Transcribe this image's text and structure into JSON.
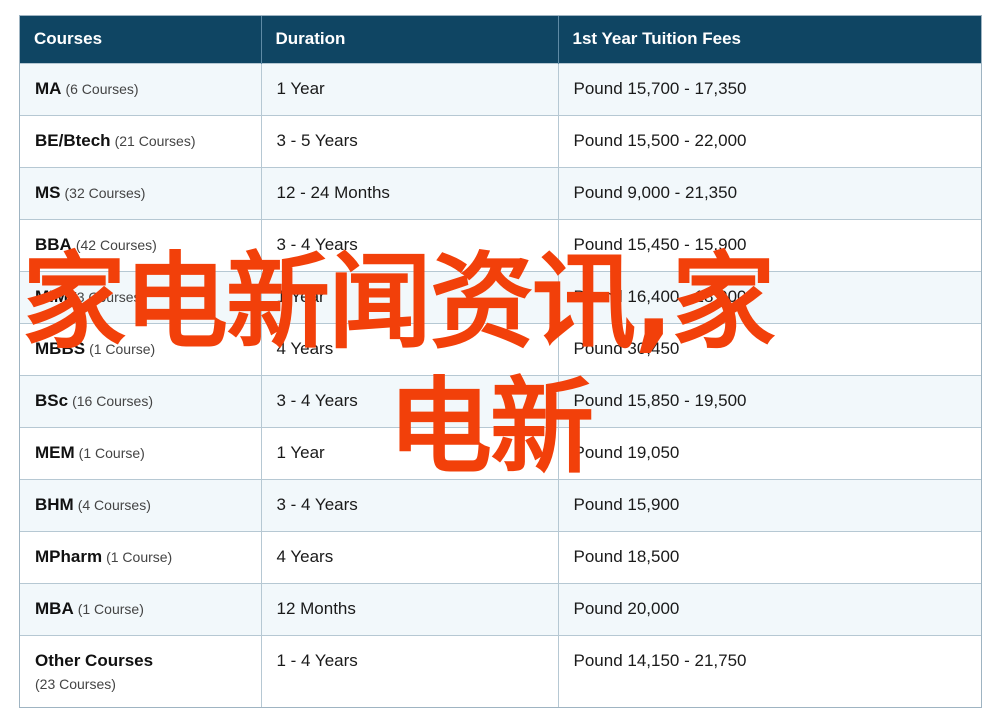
{
  "table": {
    "headers": [
      "Courses",
      "Duration",
      "1st Year Tuition Fees"
    ],
    "rows": [
      {
        "course": "MA",
        "count": "(6 Courses)",
        "duration": "1 Year",
        "fees": "Pound 15,700 - 17,350"
      },
      {
        "course": "BE/Btech",
        "count": "(21 Courses)",
        "duration": "3 - 5 Years",
        "fees": "Pound 15,500 - 22,000"
      },
      {
        "course": "MS",
        "count": "(32 Courses)",
        "duration": "12 - 24 Months",
        "fees": "Pound 9,000 - 21,350"
      },
      {
        "course": "BBA",
        "count": "(42 Courses)",
        "duration": "3 - 4 Years",
        "fees": "Pound 15,450 - 15,900"
      },
      {
        "course": "MIM",
        "count": "(3 Courses)",
        "duration": "1 Year",
        "fees": "Pound 16,400 - 18,900"
      },
      {
        "course": "MBBS",
        "count": "(1 Course)",
        "duration": "4 Years",
        "fees": "Pound 30,450"
      },
      {
        "course": "BSc",
        "count": "(16 Courses)",
        "duration": "3 - 4 Years",
        "fees": "Pound 15,850 - 19,500"
      },
      {
        "course": "MEM",
        "count": "(1 Course)",
        "duration": "1 Year",
        "fees": "Pound 19,050"
      },
      {
        "course": "BHM",
        "count": "(4 Courses)",
        "duration": "3 - 4 Years",
        "fees": "Pound 15,900"
      },
      {
        "course": "MPharm",
        "count": "(1 Course)",
        "duration": "4 Years",
        "fees": "Pound 18,500"
      },
      {
        "course": "MBA",
        "count": "(1 Course)",
        "duration": "12 Months",
        "fees": "Pound 20,000"
      },
      {
        "course": "Other Courses",
        "count": "(23 Courses)",
        "duration": "1 - 4 Years",
        "fees": "Pound 14,150 - 21,750"
      }
    ]
  },
  "watermark": {
    "line1": "家电新闻资讯,家",
    "line2": "电新",
    "color": "#f2400a"
  },
  "colors": {
    "header_bg": "#0f4563",
    "row_alt_bg": "#f2f8fb",
    "border": "#b6c8d3"
  }
}
